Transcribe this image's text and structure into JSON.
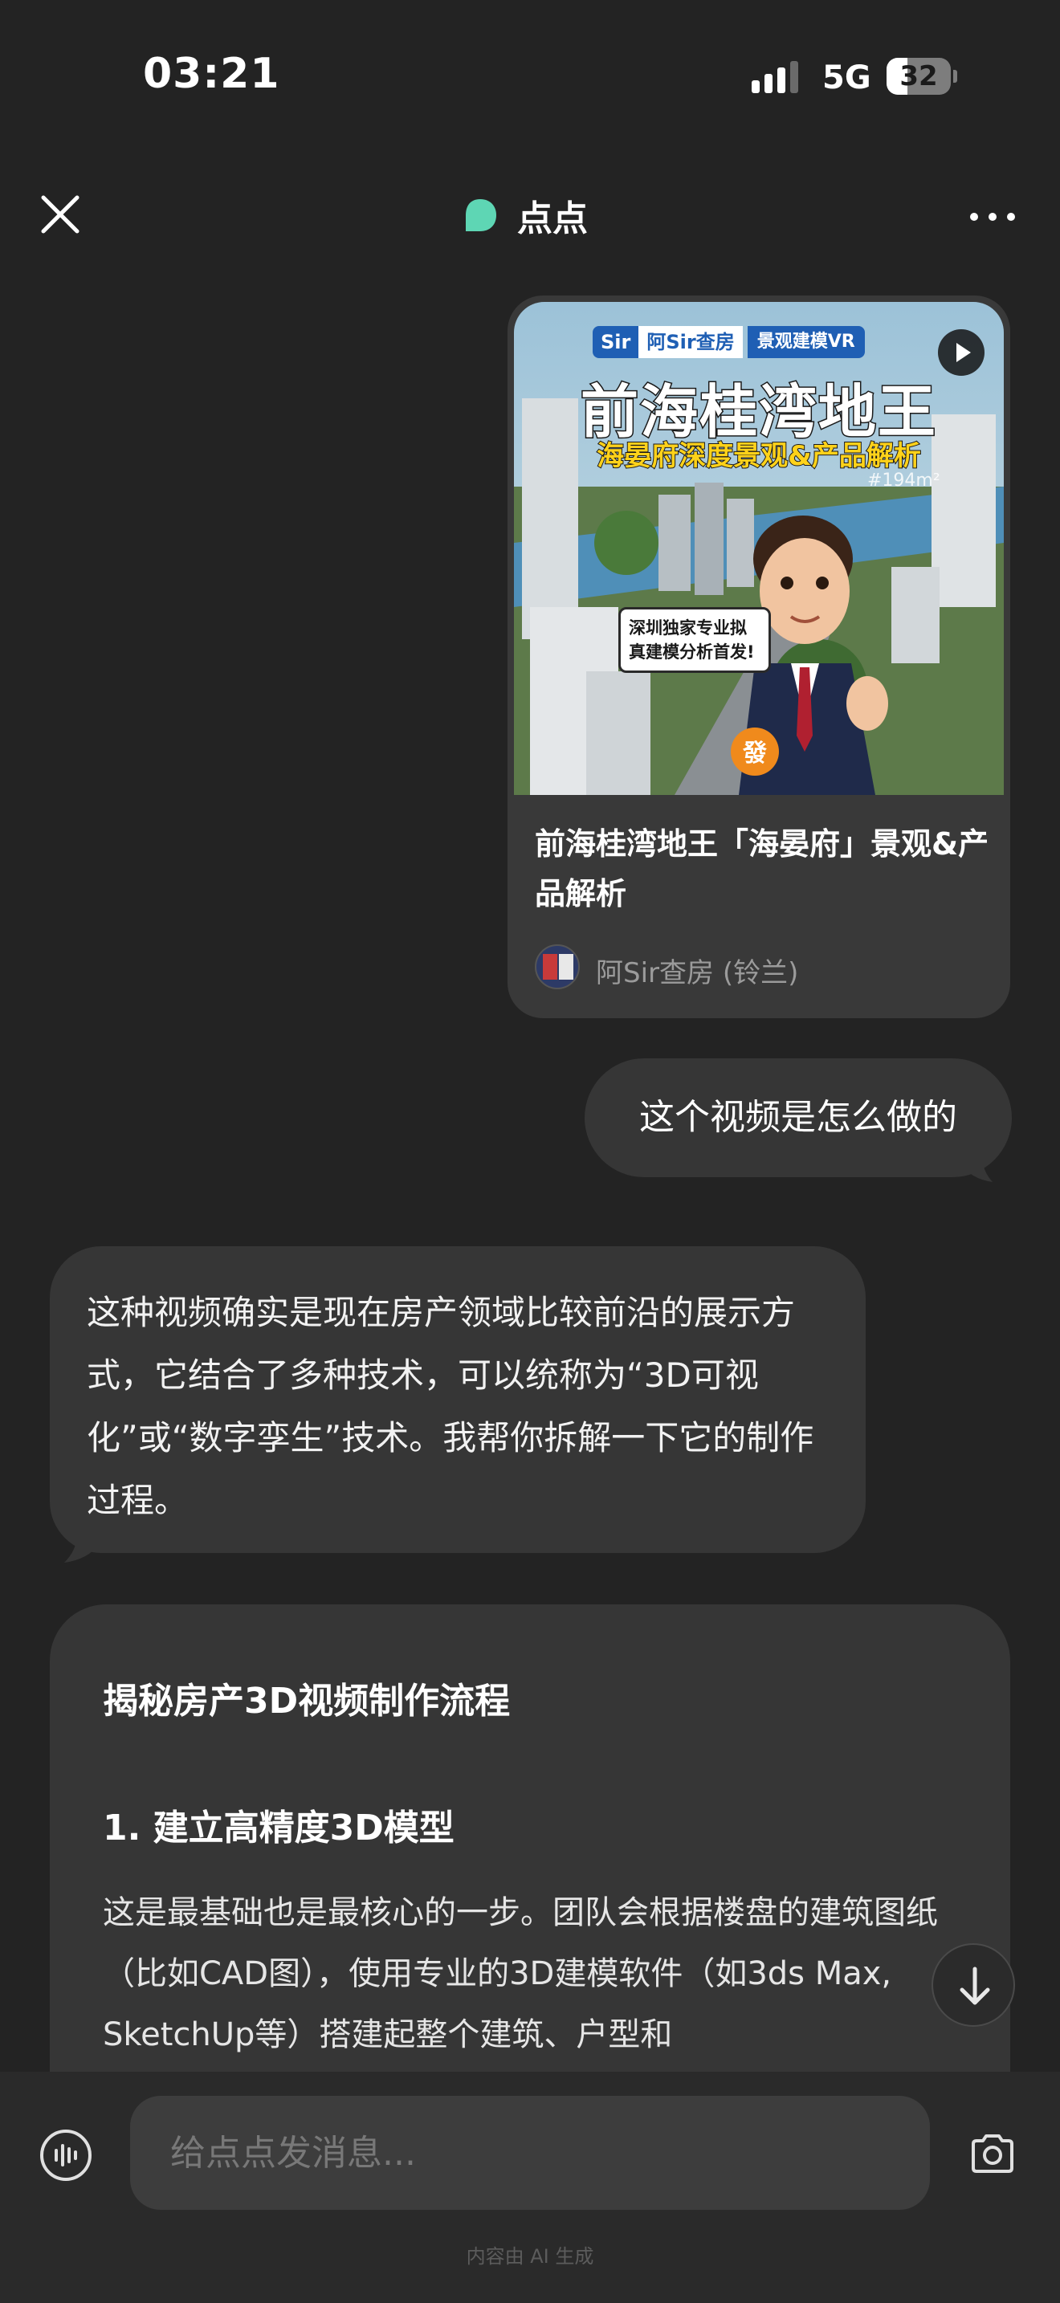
{
  "status_bar": {
    "time": "03:21",
    "network": "5G",
    "battery": "32",
    "battery_level": 0.32
  },
  "header": {
    "title": "点点",
    "logo_color": "#5ed6b4"
  },
  "video_card": {
    "badge_sir": "Sir",
    "badge_name": "阿Sir查房",
    "badge_vr": "景观建模VR",
    "thumb_title": "前海桂湾地王",
    "thumb_subtitle": "海晏府深度景观&产品解析",
    "thumb_tag": "#194m²",
    "thumb_note": "深圳独家专业拟真建模分析首发!",
    "title": "前海桂湾地王「海晏府」景观&产品解析",
    "author": "阿Sir查房 (铃兰)"
  },
  "messages": {
    "user_text": "这个视频是怎么做的",
    "ai_text": "这种视频确实是现在房产领域比较前沿的展示方式，它结合了多种技术，可以统称为“3D可视化”或“数字孪生”技术。我帮你拆解一下它的制作过程。"
  },
  "article": {
    "title": "揭秘房产3D视频制作流程",
    "section1": "1. 建立高精度3D模型",
    "body": "这是最基础也是最核心的一步。团队会根据楼盘的建筑图纸（比如CAD图），使用专业的3D建模软件（如3ds Max, SketchUp等）搭建起整个建筑、户型和"
  },
  "input": {
    "placeholder": "给点点发消息..."
  },
  "footer": {
    "note": "内容由 AI 生成"
  },
  "icons": {
    "close": "close-icon",
    "more": "more-icon",
    "play": "play-icon",
    "voice": "voice-icon",
    "camera": "camera-icon",
    "scroll_down": "arrow-down-icon"
  }
}
